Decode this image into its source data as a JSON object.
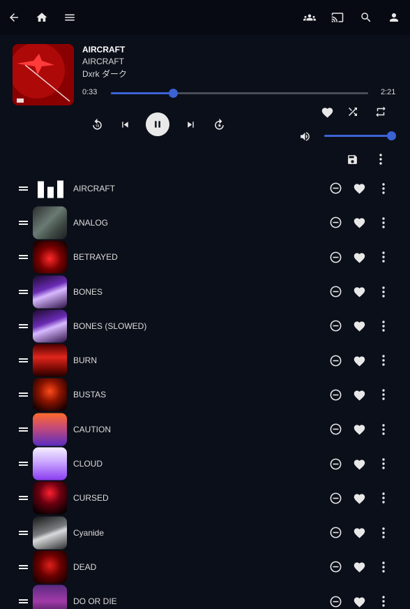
{
  "colors": {
    "background": "#0b0f19",
    "topbar": "#070a12",
    "accent": "#3b63d6",
    "track": "#4a4d59",
    "text": "#dcdcdc"
  },
  "topbar": {
    "left_icons": [
      "back-arrow-icon",
      "home-icon",
      "menu-icon"
    ],
    "right_icons": [
      "group-icon",
      "cast-icon",
      "search-icon",
      "account-icon"
    ]
  },
  "now_playing": {
    "title": "AIRCRAFT",
    "album": "AIRCRAFT",
    "artist": "Dxrk ダーク",
    "current_time": "0:33",
    "total_time": "2:21",
    "progress_fraction": 0.24,
    "volume_fraction": 1.0,
    "controls": [
      "replay-10-icon",
      "skip-previous-icon",
      "pause-icon",
      "skip-next-icon",
      "forward-10-icon"
    ],
    "actions": [
      "heart-icon",
      "shuffle-icon",
      "repeat-icon",
      "volume-icon",
      "save-icon",
      "more-vert-icon"
    ]
  },
  "queue": [
    {
      "title": "AIRCRAFT",
      "art": "bars"
    },
    {
      "title": "ANALOG",
      "art": "analog"
    },
    {
      "title": "BETRAYED",
      "art": "betrayed"
    },
    {
      "title": "BONES",
      "art": "bones"
    },
    {
      "title": "BONES (SLOWED)",
      "art": "bones"
    },
    {
      "title": "BURN",
      "art": "burn"
    },
    {
      "title": "BUSTAS",
      "art": "bustas"
    },
    {
      "title": "CAUTION",
      "art": "caution"
    },
    {
      "title": "CLOUD",
      "art": "cloud"
    },
    {
      "title": "CURSED",
      "art": "cursed"
    },
    {
      "title": "Cyanide",
      "art": "cyanide"
    },
    {
      "title": "DEAD",
      "art": "dead"
    },
    {
      "title": "DO OR DIE",
      "art": "doordie"
    }
  ]
}
